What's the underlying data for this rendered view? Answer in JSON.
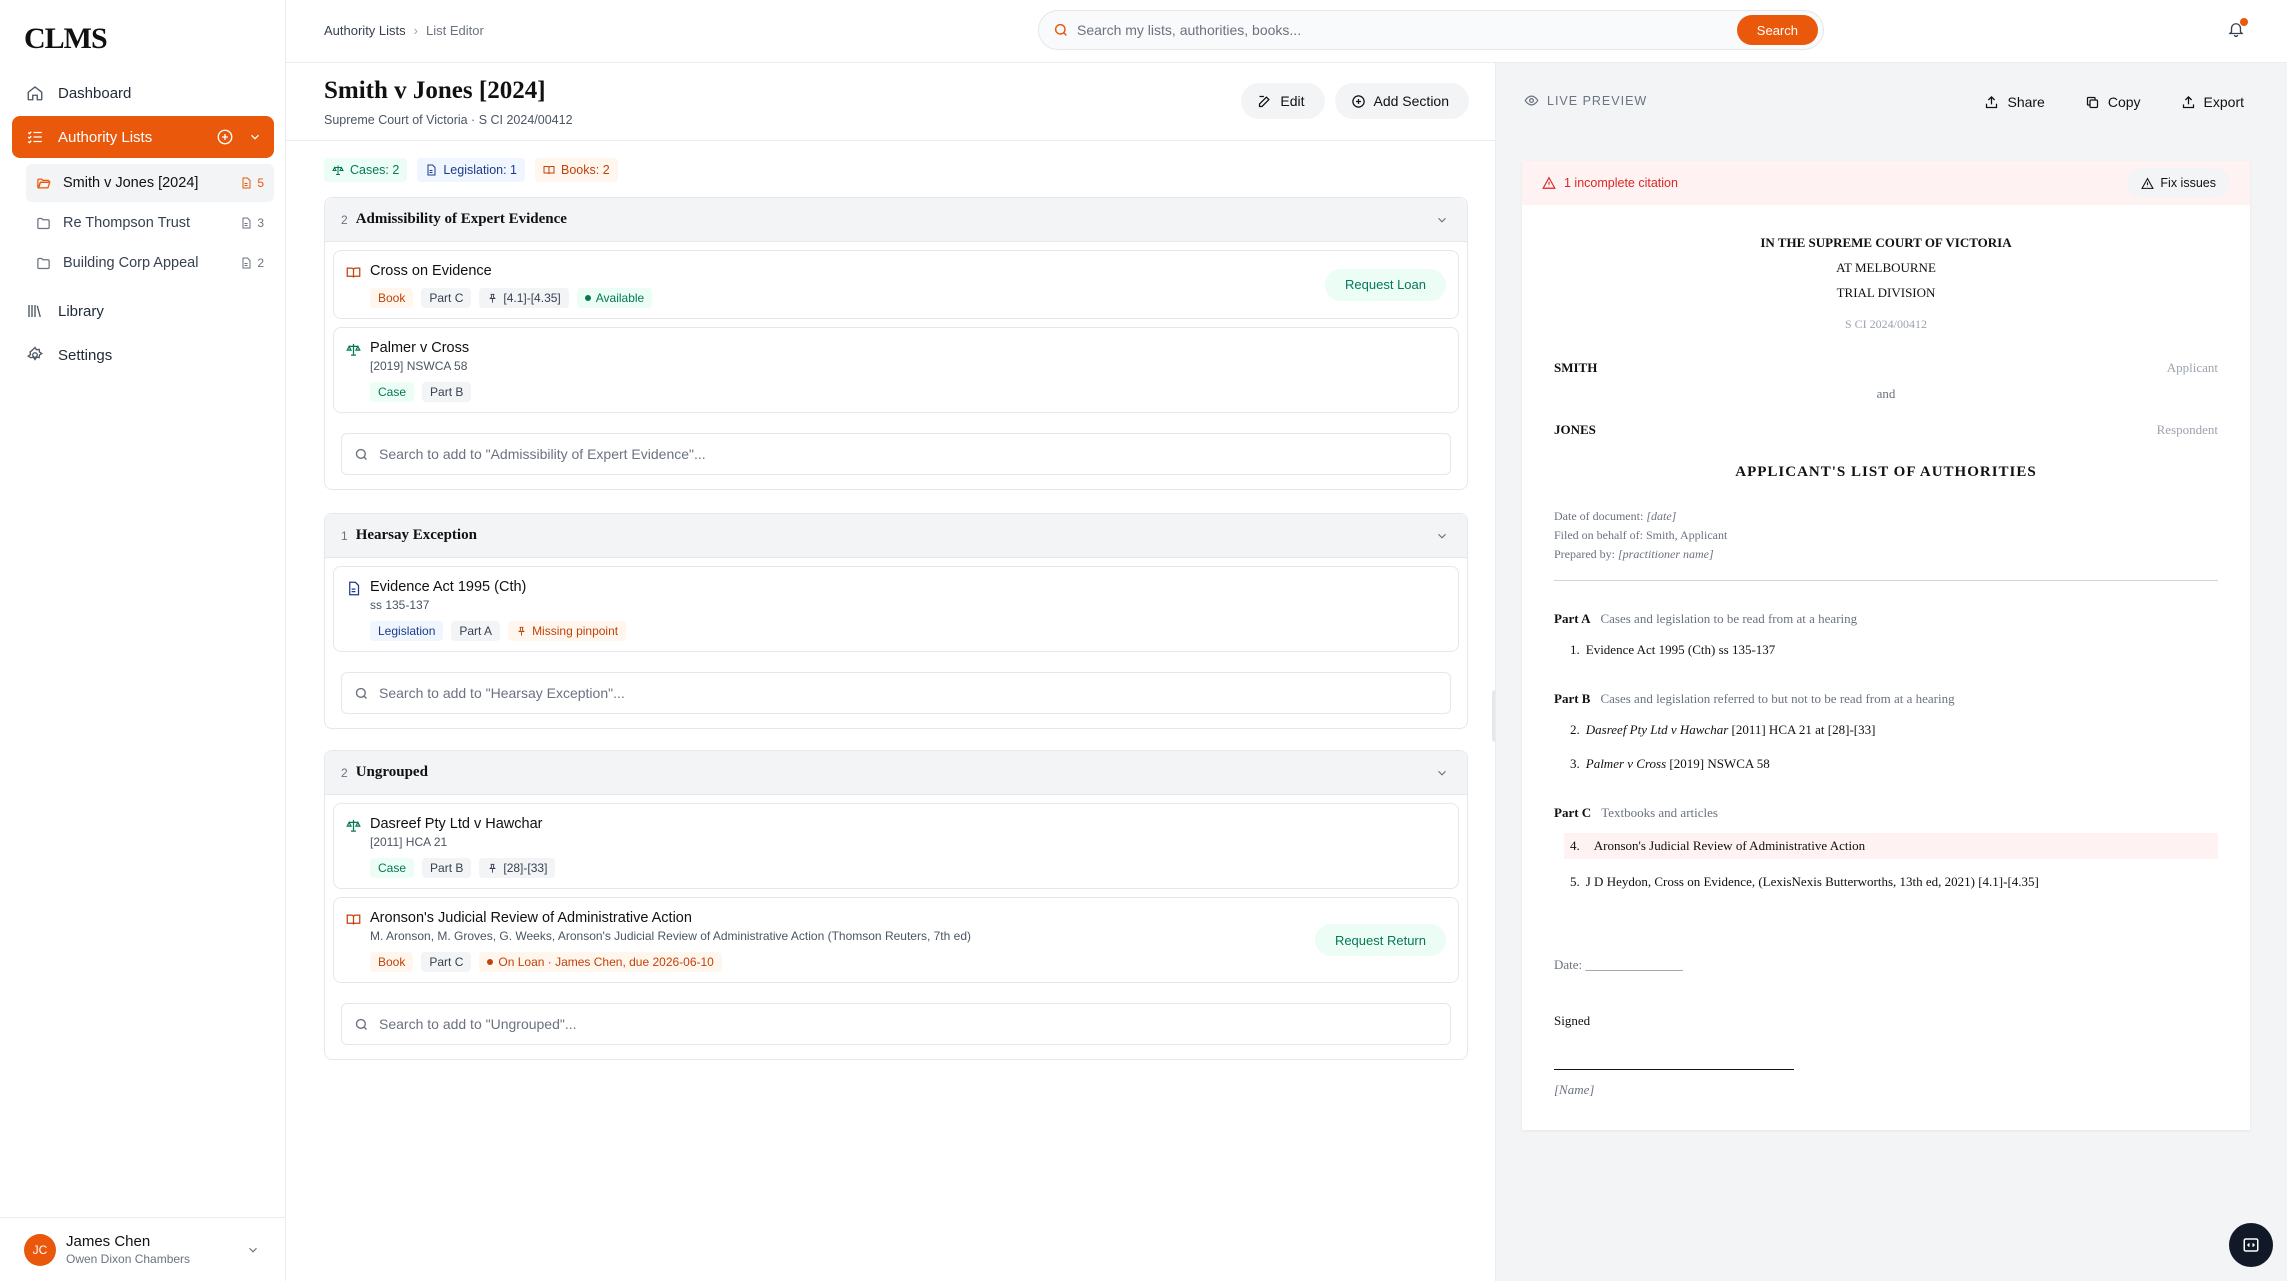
{
  "app": {
    "logo": "CLMS"
  },
  "sidebar": {
    "nav": {
      "dashboard": "Dashboard",
      "authority_lists": "Authority Lists",
      "library": "Library",
      "settings": "Settings"
    },
    "lists": [
      {
        "name": "Smith v Jones [2024]",
        "count": "5"
      },
      {
        "name": "Re Thompson Trust",
        "count": "3"
      },
      {
        "name": "Building Corp Appeal",
        "count": "2"
      }
    ],
    "user": {
      "initials": "JC",
      "name": "James Chen",
      "org": "Owen Dixon Chambers"
    }
  },
  "header": {
    "breadcrumb": {
      "root": "Authority Lists",
      "separator": "›",
      "current": "List Editor"
    },
    "search": {
      "placeholder": "Search my lists, authorities, books...",
      "button": "Search"
    }
  },
  "editor": {
    "title": "Smith v Jones [2024]",
    "subtitle": "Supreme Court of Victoria · S CI 2024/00412",
    "buttons": {
      "edit": "Edit",
      "add_section": "Add Section"
    },
    "summary": {
      "cases": "Cases: 2",
      "legislation": "Legislation: 1",
      "books": "Books: 2"
    },
    "sections": [
      {
        "count": "2",
        "title": "Admissibility of Expert Evidence",
        "search_placeholder": "Search to add to \"Admissibility of Expert Evidence\"...",
        "items": [
          {
            "title": "Cross on Evidence",
            "type": "Book",
            "part": "Part C",
            "pinpoint": "[4.1]-[4.35]",
            "status": "Available",
            "action": "Request Loan"
          },
          {
            "title": "Palmer v Cross",
            "citation": "[2019] NSWCA 58",
            "type": "Case",
            "part": "Part B"
          }
        ]
      },
      {
        "count": "1",
        "title": "Hearsay Exception",
        "search_placeholder": "Search to add to \"Hearsay Exception\"...",
        "items": [
          {
            "title": "Evidence Act 1995 (Cth)",
            "citation": "ss 135-137",
            "type": "Legislation",
            "part": "Part A",
            "warning": "Missing pinpoint"
          }
        ]
      },
      {
        "count": "2",
        "title": "Ungrouped",
        "search_placeholder": "Search to add to \"Ungrouped\"...",
        "items": [
          {
            "title": "Dasreef Pty Ltd v Hawchar",
            "citation": "[2011] HCA 21",
            "type": "Case",
            "part": "Part B",
            "pinpoint": "[28]-[33]"
          },
          {
            "title": "Aronson's Judicial Review of Administrative Action",
            "citation": "M. Aronson, M. Groves, G. Weeks, Aronson's Judicial Review of Administrative Action (Thomson Reuters, 7th ed)",
            "type": "Book",
            "part": "Part C",
            "status": "On Loan · James Chen, due 2026-06-10",
            "action": "Request Return"
          }
        ]
      }
    ]
  },
  "preview": {
    "label": "LIVE PREVIEW",
    "actions": {
      "share": "Share",
      "copy": "Copy",
      "export": "Export"
    },
    "alert": {
      "text": "1 incomplete citation",
      "button": "Fix issues"
    },
    "doc": {
      "court": "IN THE SUPREME COURT OF VICTORIA",
      "location": "AT MELBOURNE",
      "division": "TRIAL DIVISION",
      "file_no": "S CI 2024/00412",
      "applicant": {
        "name": "SMITH",
        "role": "Applicant"
      },
      "and": "and",
      "respondent": {
        "name": "JONES",
        "role": "Respondent"
      },
      "title": "APPLICANT'S LIST OF AUTHORITIES",
      "meta": {
        "date_label": "Date of document:",
        "date_value": "[date]",
        "filed": "Filed on behalf of: Smith, Applicant",
        "prepared_label": "Prepared by:",
        "prepared_value": "[practitioner name]"
      },
      "parts": [
        {
          "label": "Part A",
          "desc": "Cases and legislation to be read from at a hearing"
        },
        {
          "label": "Part B",
          "desc": "Cases and legislation referred to but not to be read from at a hearing"
        },
        {
          "label": "Part C",
          "desc": "Textbooks and articles"
        }
      ],
      "entries": {
        "e1": {
          "num": "1.",
          "text": "Evidence Act 1995 (Cth) ss 135-137"
        },
        "e2": {
          "num": "2.",
          "name": "Dasreef Pty Ltd v Hawchar",
          "rest": " [2011] HCA 21 at [28]-[33]"
        },
        "e3": {
          "num": "3.",
          "name": "Palmer v Cross",
          "rest": " [2019] NSWCA 58"
        },
        "e4": {
          "num": "4.",
          "text": "Aronson's Judicial Review of Administrative Action"
        },
        "e5": {
          "num": "5.",
          "text": "J D Heydon, Cross on Evidence, (LexisNexis Butterworths, 13th ed, 2021) [4.1]-[4.35]"
        }
      },
      "date_line": "Date: _______________",
      "signed": "Signed",
      "name_placeholder": "[Name]"
    }
  },
  "colors": {
    "accent": "#ea580c",
    "case": "#047857",
    "legislation": "#1e3a8a",
    "book": "#c2410c",
    "alert": "#dc2626"
  }
}
